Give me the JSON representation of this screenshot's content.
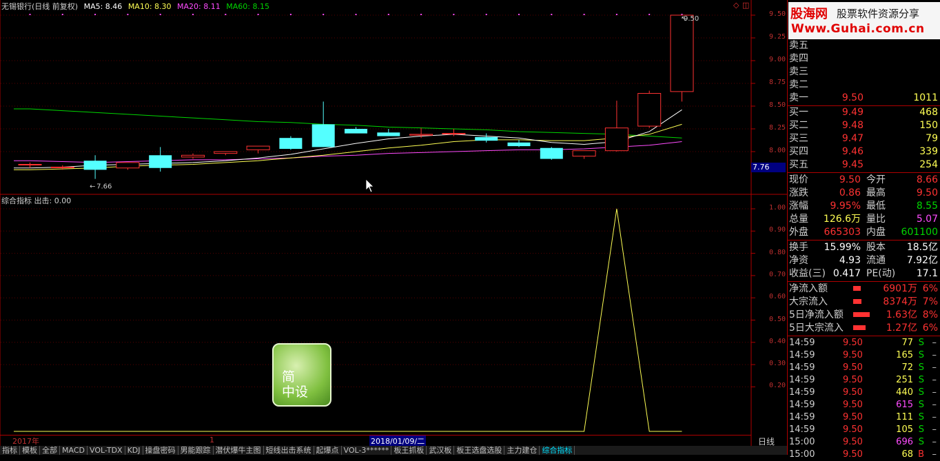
{
  "chart_header": {
    "stock": "无锡银行(日线 前复权)",
    "ma5": "MA5: 8.46",
    "ma10": "MA10: 8.30",
    "ma20": "MA20: 8.11",
    "ma60": "MA60: 8.15",
    "colors": {
      "ma5": "#ffffff",
      "ma10": "#ffff54",
      "ma20": "#ff4cff",
      "ma60": "#00d600"
    }
  },
  "indicator_header": "综合指标 出击: 0.00",
  "price_axis": [
    "9.50",
    "9.25",
    "9.00",
    "8.75",
    "8.50",
    "8.25",
    "8.00"
  ],
  "indicator_axis": [
    "1.00",
    "0.90",
    "0.80",
    "0.70",
    "0.60",
    "0.50",
    "0.40",
    "0.30",
    "0.20"
  ],
  "current_price_tag": "7.76",
  "annotations": {
    "high": "9.50",
    "low": "7.66"
  },
  "chart_data": {
    "type": "candlestick",
    "ylim": [
      7.6,
      9.55
    ],
    "candles": [
      {
        "o": 7.86,
        "h": 7.88,
        "l": 7.82,
        "c": 7.86
      },
      {
        "o": 7.83,
        "h": 7.85,
        "l": 7.8,
        "c": 7.83
      },
      {
        "o": 7.9,
        "h": 7.96,
        "l": 7.7,
        "c": 7.8
      },
      {
        "o": 7.82,
        "h": 7.88,
        "l": 7.8,
        "c": 7.88
      },
      {
        "o": 7.96,
        "h": 8.05,
        "l": 7.78,
        "c": 7.82
      },
      {
        "o": 7.94,
        "h": 7.98,
        "l": 7.92,
        "c": 7.96
      },
      {
        "o": 7.98,
        "h": 8.0,
        "l": 7.96,
        "c": 8.0
      },
      {
        "o": 8.02,
        "h": 8.04,
        "l": 7.98,
        "c": 8.06
      },
      {
        "o": 8.15,
        "h": 8.17,
        "l": 8.02,
        "c": 8.03
      },
      {
        "o": 8.3,
        "h": 8.55,
        "l": 8.05,
        "c": 8.05
      },
      {
        "o": 8.25,
        "h": 8.27,
        "l": 8.22,
        "c": 8.2
      },
      {
        "o": 8.21,
        "h": 8.25,
        "l": 8.19,
        "c": 8.17
      },
      {
        "o": 8.18,
        "h": 8.26,
        "l": 8.15,
        "c": 8.19
      },
      {
        "o": 8.2,
        "h": 8.25,
        "l": 8.17,
        "c": 8.2
      },
      {
        "o": 8.16,
        "h": 8.2,
        "l": 8.1,
        "c": 8.12
      },
      {
        "o": 8.1,
        "h": 8.13,
        "l": 8.05,
        "c": 8.06
      },
      {
        "o": 8.04,
        "h": 8.05,
        "l": 7.91,
        "c": 7.92
      },
      {
        "o": 7.95,
        "h": 8.01,
        "l": 7.92,
        "c": 8.01
      },
      {
        "o": 8.01,
        "h": 8.56,
        "l": 8.0,
        "c": 8.26
      },
      {
        "o": 8.28,
        "h": 8.67,
        "l": 8.26,
        "c": 8.64
      },
      {
        "o": 8.66,
        "h": 9.5,
        "l": 8.55,
        "c": 9.5
      }
    ],
    "ma": {
      "ma5": [
        7.82,
        7.83,
        7.85,
        7.86,
        7.87,
        7.88,
        7.9,
        7.93,
        7.97,
        8.03,
        8.09,
        8.14,
        8.17,
        8.19,
        8.17,
        8.15,
        8.1,
        8.08,
        8.11,
        8.22,
        8.46
      ],
      "ma10": [
        7.8,
        7.81,
        7.82,
        7.84,
        7.85,
        7.86,
        7.88,
        7.9,
        7.93,
        7.96,
        8.0,
        8.04,
        8.07,
        8.11,
        8.13,
        8.13,
        8.12,
        8.12,
        8.15,
        8.19,
        8.3
      ],
      "ma20": [
        7.9,
        7.89,
        7.88,
        7.89,
        7.9,
        7.91,
        7.91,
        7.92,
        7.93,
        7.95,
        7.96,
        7.98,
        7.99,
        8.0,
        8.01,
        8.02,
        8.02,
        8.03,
        8.05,
        8.07,
        8.11
      ],
      "ma60": [
        8.47,
        8.45,
        8.43,
        8.41,
        8.39,
        8.37,
        8.35,
        8.33,
        8.32,
        8.3,
        8.29,
        8.27,
        8.26,
        8.25,
        8.24,
        8.22,
        8.21,
        8.2,
        8.19,
        8.17,
        8.15
      ]
    },
    "indicator": {
      "name": "出击",
      "values": [
        0,
        0,
        0,
        0,
        0,
        0,
        0,
        0,
        0,
        0,
        0,
        0,
        0,
        0,
        0,
        0,
        0,
        0,
        1,
        0,
        0
      ],
      "ylim": [
        0,
        1.05
      ]
    }
  },
  "quote_panel": {
    "logo": {
      "brand": "股海网",
      "tagline": "股票软件资源分享",
      "url": "Www.Guhai.com.cn"
    },
    "sell": [
      {
        "label": "卖五",
        "price": "",
        "vol": ""
      },
      {
        "label": "卖四",
        "price": "",
        "vol": ""
      },
      {
        "label": "卖三",
        "price": "",
        "vol": ""
      },
      {
        "label": "卖二",
        "price": "",
        "vol": ""
      },
      {
        "label": "卖一",
        "price": "9.50",
        "vol": "1011"
      }
    ],
    "buy": [
      {
        "label": "买一",
        "price": "9.49",
        "vol": "468"
      },
      {
        "label": "买二",
        "price": "9.48",
        "vol": "150"
      },
      {
        "label": "买三",
        "price": "9.47",
        "vol": "79"
      },
      {
        "label": "买四",
        "price": "9.46",
        "vol": "339"
      },
      {
        "label": "买五",
        "price": "9.45",
        "vol": "254"
      }
    ],
    "quote": [
      {
        "k1": "现价",
        "v1": "9.50",
        "c1": "red",
        "k2": "今开",
        "v2": "8.66",
        "c2": "red"
      },
      {
        "k1": "涨跌",
        "v1": "0.86",
        "c1": "red",
        "k2": "最高",
        "v2": "9.50",
        "c2": "red"
      },
      {
        "k1": "涨幅",
        "v1": "9.95%",
        "c1": "red",
        "k2": "最低",
        "v2": "8.55",
        "c2": "green"
      },
      {
        "k1": "总量",
        "v1": "126.6万",
        "c1": "yellow",
        "k2": "量比",
        "v2": "5.07",
        "c2": "magenta"
      },
      {
        "k1": "外盘",
        "v1": "665303",
        "c1": "red",
        "k2": "内盘",
        "v2": "601100",
        "c2": "green"
      }
    ],
    "fin": [
      {
        "k1": "换手",
        "v1": "15.99%",
        "k2": "股本",
        "v2": "18.5亿"
      },
      {
        "k1": "净资",
        "v1": "4.93",
        "k2": "流通",
        "v2": "7.92亿"
      },
      {
        "k1": "收益(三)",
        "v1": "0.417",
        "k2": "PE(动)",
        "v2": "17.1"
      }
    ],
    "flow": [
      {
        "label": "净流入额",
        "value": "6901万",
        "pct": "6%",
        "bar": 0.45
      },
      {
        "label": "大宗流入",
        "value": "8374万",
        "pct": "7%",
        "bar": 0.5
      },
      {
        "label": "5日净流入额",
        "value": "1.63亿",
        "pct": "8%",
        "bar": 1.0
      },
      {
        "label": "5日大宗流入",
        "value": "1.27亿",
        "pct": "6%",
        "bar": 0.75
      }
    ],
    "ticks": [
      {
        "time": "14:59",
        "price": "9.50",
        "vol": "77",
        "bs": "S",
        "color": "yellow"
      },
      {
        "time": "14:59",
        "price": "9.50",
        "vol": "165",
        "bs": "S",
        "color": "yellow"
      },
      {
        "time": "14:59",
        "price": "9.50",
        "vol": "72",
        "bs": "S",
        "color": "yellow"
      },
      {
        "time": "14:59",
        "price": "9.50",
        "vol": "251",
        "bs": "S",
        "color": "yellow"
      },
      {
        "time": "14:59",
        "price": "9.50",
        "vol": "440",
        "bs": "S",
        "color": "yellow"
      },
      {
        "time": "14:59",
        "price": "9.50",
        "vol": "615",
        "bs": "S",
        "color": "magenta"
      },
      {
        "time": "14:59",
        "price": "9.50",
        "vol": "111",
        "bs": "S",
        "color": "yellow"
      },
      {
        "time": "14:59",
        "price": "9.50",
        "vol": "105",
        "bs": "S",
        "color": "yellow"
      },
      {
        "time": "15:00",
        "price": "9.50",
        "vol": "696",
        "bs": "S",
        "color": "magenta"
      },
      {
        "time": "15:00",
        "price": "9.50",
        "vol": "68",
        "bs": "B",
        "color": "yellow"
      }
    ],
    "tick_dash": "–"
  },
  "datebar": {
    "year": "2017年",
    "mark": "1",
    "cursor_date": "2018/01/09/二"
  },
  "period": "日线",
  "tabs": [
    "指标",
    "模板",
    "全部",
    "MACD",
    "VOL-TDX",
    "KDJ",
    "操盘密码",
    "男能跟踪",
    "潜伏爆牛主图",
    "短线出击系统",
    "起爆点",
    "VOL-3******",
    "板王抓板",
    "武汉板",
    "板王选盘选股",
    "主力建仓",
    "综合指标"
  ],
  "watermark": {
    "line1": "简",
    "line2": "中设"
  },
  "ctrl_icons": [
    "◇",
    "◫"
  ],
  "scroll_ctrls": [
    "+",
    "-",
    "0"
  ]
}
